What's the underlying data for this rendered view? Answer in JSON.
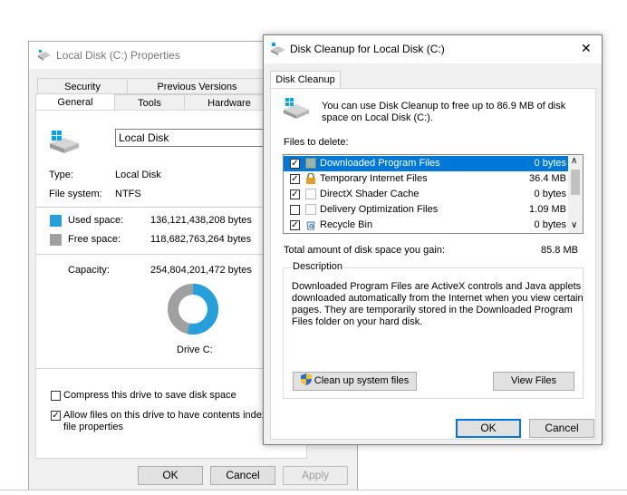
{
  "props": {
    "title": "Local Disk (C:) Properties",
    "tabs_row1": [
      "Security",
      "Previous Versions"
    ],
    "tabs_row2": [
      "General",
      "Tools",
      "Hardware"
    ],
    "drive_name": "Local Disk",
    "type_label": "Type:",
    "type_value": "Local Disk",
    "fs_label": "File system:",
    "fs_value": "NTFS",
    "used_label": "Used space:",
    "used_value": "136,121,438,208 bytes",
    "free_label": "Free space:",
    "free_value": "118,682,763,264 bytes",
    "capacity_label": "Capacity:",
    "capacity_value": "254,804,201,472 bytes",
    "drive_caption": "Drive C:",
    "used_fraction": 0.534,
    "compress_label": "Compress this drive to save disk space",
    "compress_checked": false,
    "index_label_1": "Allow files on this drive to have contents indexe",
    "index_label_2": "file properties",
    "index_checked": true,
    "ok": "OK",
    "cancel": "Cancel",
    "apply": "Apply",
    "colors": {
      "used": "#26a0da",
      "free": "#a0a0a0"
    }
  },
  "cleanup": {
    "title": "Disk Cleanup for Local Disk  (C:)",
    "close_glyph": "✕",
    "tab": "Disk Cleanup",
    "intro_line1": "You can use Disk Cleanup to free up to 86.9 MB of disk",
    "intro_line2": "space on Local Disk (C:).",
    "files_label": "Files to delete:",
    "files": [
      {
        "name": "Downloaded Program Files",
        "size": "0 bytes",
        "checked": true,
        "icon": "folder-icon",
        "selected": true
      },
      {
        "name": "Temporary Internet Files",
        "size": "36.4 MB",
        "checked": true,
        "icon": "lock-icon",
        "selected": false
      },
      {
        "name": "DirectX Shader Cache",
        "size": "0 bytes",
        "checked": true,
        "icon": "blank-file-icon",
        "selected": false
      },
      {
        "name": "Delivery Optimization Files",
        "size": "1.09 MB",
        "checked": false,
        "icon": "blank-file-icon",
        "selected": false
      },
      {
        "name": "Recycle Bin",
        "size": "0 bytes",
        "checked": true,
        "icon": "recycle-bin-icon",
        "selected": false
      }
    ],
    "total_label": "Total amount of disk space you gain:",
    "total_value": "85.8 MB",
    "description_label": "Description",
    "description_lines": [
      "Downloaded Program Files are ActiveX controls and Java applets",
      "downloaded automatically from the Internet when you view certain",
      "pages. They are temporarily stored in the Downloaded Program",
      "Files folder on your hard disk."
    ],
    "cleanup_system_button": "Clean up system files",
    "view_files_button": "View Files",
    "ok": "OK",
    "cancel": "Cancel"
  }
}
